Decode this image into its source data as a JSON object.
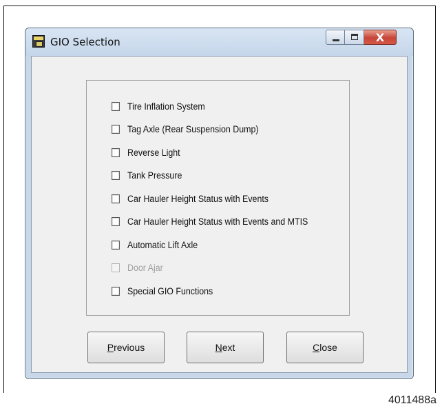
{
  "window": {
    "title": "GIO Selection",
    "icon": "app-icon",
    "close_glyph": "X"
  },
  "options": [
    {
      "label": "Tire Inflation System",
      "checked": false,
      "enabled": true
    },
    {
      "label": "Tag Axle (Rear Suspension Dump)",
      "checked": false,
      "enabled": true
    },
    {
      "label": "Reverse Light",
      "checked": false,
      "enabled": true
    },
    {
      "label": "Tank Pressure",
      "checked": false,
      "enabled": true
    },
    {
      "label": "Car Hauler Height Status with Events",
      "checked": false,
      "enabled": true
    },
    {
      "label": "Car Hauler Height Status with Events and MTIS",
      "checked": false,
      "enabled": true
    },
    {
      "label": "Automatic Lift Axle",
      "checked": false,
      "enabled": true
    },
    {
      "label": "Door Ajar",
      "checked": false,
      "enabled": false
    },
    {
      "label": "Special GIO Functions",
      "checked": false,
      "enabled": true
    }
  ],
  "buttons": {
    "previous": {
      "mnemonic": "P",
      "rest": "revious"
    },
    "next": {
      "mnemonic": "N",
      "rest": "ext"
    },
    "close": {
      "mnemonic": "C",
      "rest": "lose"
    }
  },
  "figure_id": "4011488a"
}
